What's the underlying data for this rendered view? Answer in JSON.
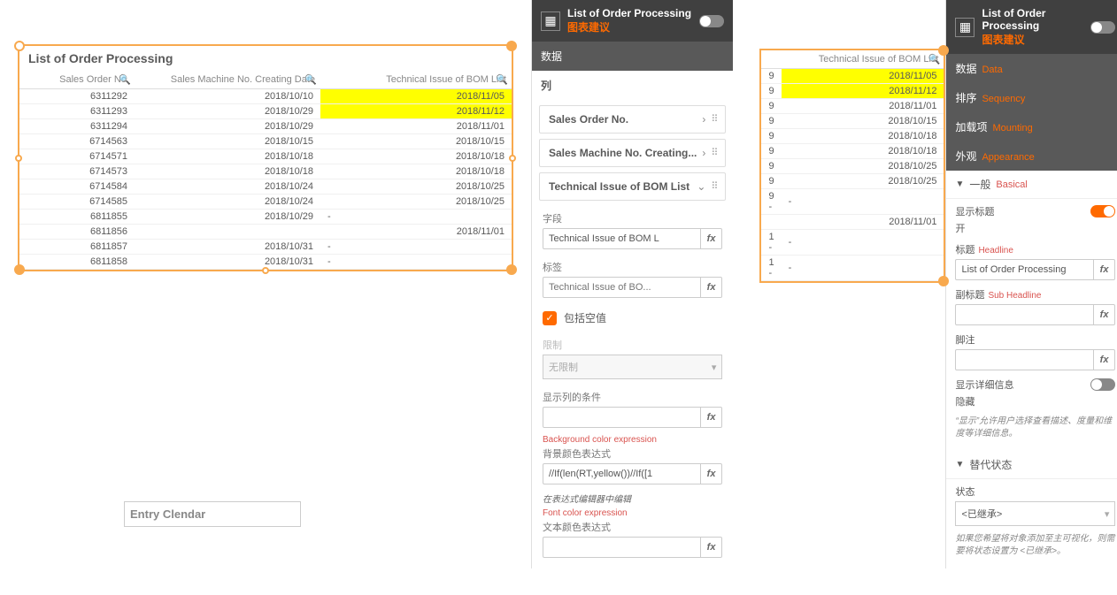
{
  "object": {
    "title": "List of Order Processing",
    "columns": [
      "Sales Order No.",
      "Sales Machine No. Creating Date",
      "Technical Issue of BOM List"
    ],
    "rows": [
      {
        "c0": "6311292",
        "c1": "2018/10/10",
        "c2": "2018/11/05",
        "hl": true
      },
      {
        "c0": "6311293",
        "c1": "2018/10/29",
        "c2": "2018/11/12",
        "hl": true
      },
      {
        "c0": "6311294",
        "c1": "2018/10/29",
        "c2": "2018/11/01"
      },
      {
        "c0": "6714563",
        "c1": "2018/10/15",
        "c2": "2018/10/15"
      },
      {
        "c0": "6714571",
        "c1": "2018/10/18",
        "c2": "2018/10/18"
      },
      {
        "c0": "6714573",
        "c1": "2018/10/18",
        "c2": "2018/10/18"
      },
      {
        "c0": "6714584",
        "c1": "2018/10/24",
        "c2": "2018/10/25"
      },
      {
        "c0": "6714585",
        "c1": "2018/10/24",
        "c2": "2018/10/25"
      },
      {
        "c0": "6811855",
        "c1": "2018/10/29",
        "c2": "-"
      },
      {
        "c0": "6811856",
        "c1": "",
        "c2": "2018/11/01"
      },
      {
        "c0": "6811857",
        "c1": "2018/10/31",
        "c2": "-"
      },
      {
        "c0": "6811858",
        "c1": "2018/10/31",
        "c2": "-"
      }
    ]
  },
  "entry_clendar": "Entry Clendar",
  "panel1": {
    "title": "List of Order Processing",
    "subtitle": "图表建议",
    "section_data": "数据",
    "section_cols": "列",
    "col_items": [
      "Sales Order No.",
      "Sales Machine No. Creating...",
      "Technical Issue of BOM List"
    ],
    "field_label": "字段",
    "field_value": "Technical Issue of BOM L",
    "label_label": "标签",
    "label_placeholder": "Technical Issue of BO...",
    "include_blank": "包括空值",
    "limit_label": "限制",
    "limit_placeholder": "无限制",
    "show_cond_label": "显示列的条件",
    "bg_expr_en": "Background color expression",
    "bg_expr_cn": "背景颜色表达式",
    "bg_expr_value": "//If(len(RT,yellow())//If([1",
    "bg_expr_note": "在表达式编辑器中编辑",
    "font_expr_en": "Font color expression",
    "font_expr_cn": "文本颜色表达式"
  },
  "object2": {
    "col": "Technical Issue of BOM List",
    "rows": [
      {
        "c2": "2018/11/05",
        "hl": true,
        "c0s": "9"
      },
      {
        "c2": "2018/11/12",
        "hl": true,
        "c0s": "9"
      },
      {
        "c2": "2018/11/01",
        "c0s": "9"
      },
      {
        "c2": "2018/10/15",
        "c0s": "9"
      },
      {
        "c2": "2018/10/18",
        "c0s": "9"
      },
      {
        "c2": "2018/10/18",
        "c0s": "9"
      },
      {
        "c2": "2018/10/25",
        "c0s": "9"
      },
      {
        "c2": "2018/10/25",
        "c0s": "9"
      },
      {
        "c2": "-",
        "c0s": "9 -"
      },
      {
        "c2": "2018/11/01",
        "c0s": ""
      },
      {
        "c2": "-",
        "c0s": "1 -"
      },
      {
        "c2": "-",
        "c0s": "1 -"
      }
    ]
  },
  "panel2": {
    "title": "List of Order Processing",
    "subtitle": "图表建议",
    "rows": [
      {
        "cn": "数据",
        "en": "Data"
      },
      {
        "cn": "排序",
        "en": "Sequency"
      },
      {
        "cn": "加载项",
        "en": "Mounting"
      },
      {
        "cn": "外观",
        "en": "Appearance"
      }
    ],
    "general": {
      "cn": "一般",
      "en": "Basical"
    },
    "show_title": {
      "label": "显示标题",
      "value": "开"
    },
    "title_field": {
      "cn": "标题",
      "en": "Headline",
      "value": "List of Order Processing"
    },
    "subtitle_field": {
      "cn": "副标题",
      "en": "Sub Headline"
    },
    "footnote_label": "脚注",
    "show_detail": {
      "label": "显示详细信息",
      "value": "隐藏"
    },
    "show_detail_hint": "“显示”允许用户选择查看描述、度量和维度等详细信息。",
    "alt_state": "替代状态",
    "state_label": "状态",
    "state_value": "<已继承>",
    "state_hint": "如果您希望将对象添加至主可视化，则需要将状态设置为 <已继承>。"
  },
  "fx": "fx"
}
